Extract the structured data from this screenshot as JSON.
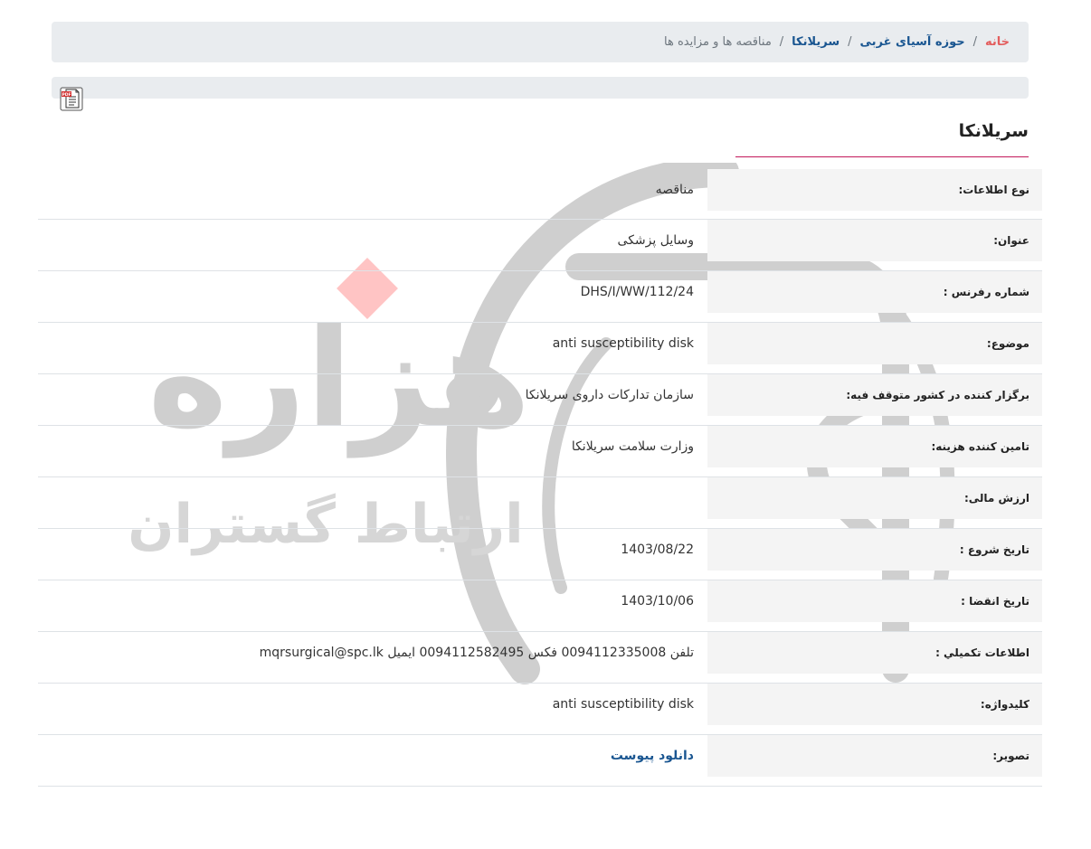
{
  "breadcrumb": {
    "items": [
      "خانه",
      "حوزه آسیای غربی",
      "سریلانکا",
      "مناقصه ها و مزایده ها"
    ],
    "separator": "/"
  },
  "toolbar": {
    "pdf_icon": "pdf-icon"
  },
  "watermark": {
    "brand_main": "هزاره",
    "brand_sub": "ارتباط گستران"
  },
  "section": {
    "title": "سریلانکا"
  },
  "details": {
    "rows": [
      {
        "label": "نوع اطلاعات:",
        "value": "مناقصه"
      },
      {
        "label": "عنوان:",
        "value": "وسایل پزشکی"
      },
      {
        "label": "شماره رفرنس :",
        "value": "DHS/I/WW/112/24"
      },
      {
        "label": "موضوع:",
        "value": "anti susceptibility disk"
      },
      {
        "label": "برگزار کننده در کشور متوقف فیه:",
        "value": "سازمان تداركات داروی سریلانکا"
      },
      {
        "label": "تامین کننده هزینه:",
        "value": "وزارت سلامت سریلانکا"
      },
      {
        "label": "ارزش مالی:",
        "value": ""
      },
      {
        "label": "تاریخ شروع :",
        "value": "1403/08/22"
      },
      {
        "label": "تاریخ انقضا :",
        "value": "1403/10/06"
      },
      {
        "label": "اطلاعات تکمیلي :",
        "value": "تلفن 0094112335008 فکس 0094112582495 ایمیل mqrsurgical@spc.lk"
      },
      {
        "label": "کلیدواژه:",
        "value": "anti susceptibility disk"
      },
      {
        "label": "تصویر:",
        "value": "دانلود پیوست"
      }
    ]
  },
  "colors": {
    "link": "#1a5691",
    "home": "#e35d5d",
    "accent_line": "#c2185b",
    "label_bg": "#f4f4f4"
  }
}
